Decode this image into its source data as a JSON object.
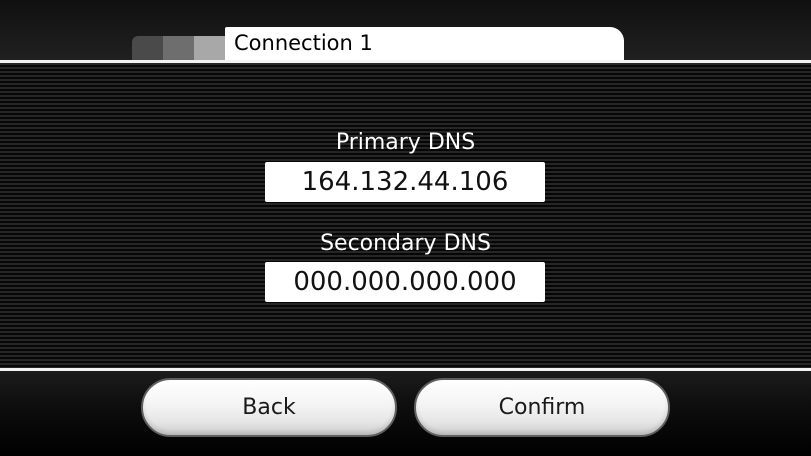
{
  "header": {
    "title": "Connection 1",
    "tab_indicators": [
      "tab-square-1",
      "tab-square-2",
      "tab-square-3"
    ]
  },
  "form": {
    "primary_dns": {
      "label": "Primary DNS",
      "value": "164.132.44.106"
    },
    "secondary_dns": {
      "label": "Secondary DNS",
      "value": "000.000.000.000"
    }
  },
  "footer": {
    "back_label": "Back",
    "confirm_label": "Confirm"
  },
  "colors": {
    "background": "#000000",
    "panel_stripe_light": "#262626",
    "panel_stripe_dark": "#060606",
    "field_background": "#ffffff",
    "button_border": "#5f5f5f"
  }
}
